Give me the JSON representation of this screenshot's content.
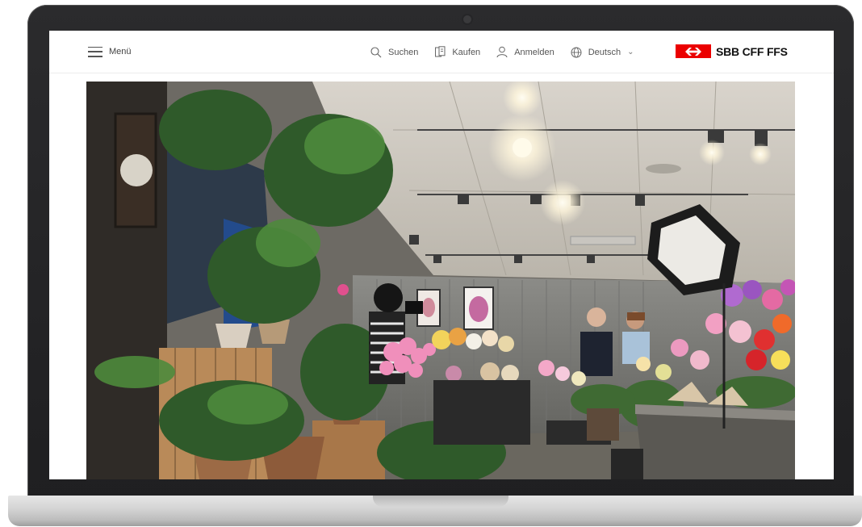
{
  "header": {
    "menu_label": "Menü",
    "search_label": "Suchen",
    "buy_label": "Kaufen",
    "login_label": "Anmelden",
    "language": {
      "selected": "Deutsch"
    },
    "logo_text": "SBB CFF FFS"
  },
  "colors": {
    "brand_red": "#eb0000",
    "nav_text": "#555555"
  },
  "icons": {
    "menu": "hamburger-icon",
    "search": "search-icon",
    "buy": "ticket-icon",
    "login": "user-icon",
    "language": "globe-icon",
    "dropdown": "chevron-down-icon",
    "logo": "sbb-logo-arrows-icon"
  }
}
